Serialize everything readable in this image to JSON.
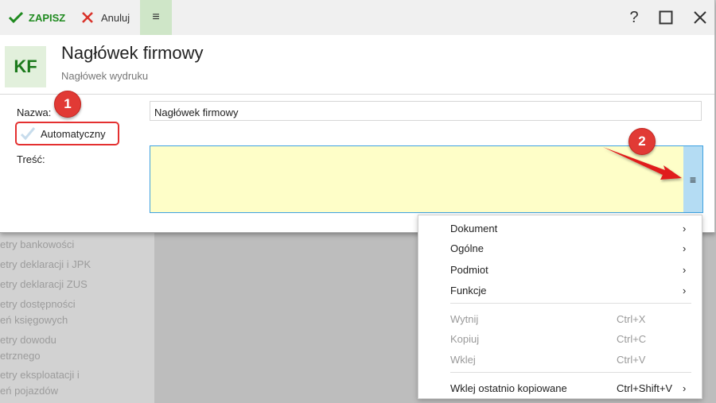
{
  "toolbar": {
    "save_label": "ZAPISZ",
    "cancel_label": "Anuluj",
    "menu_glyph": "≡",
    "help_glyph": "?",
    "maximize_glyph": "☐",
    "close_glyph": "✕"
  },
  "header": {
    "badge": "KF",
    "title": "Nagłówek firmowy",
    "subtitle": "Nagłówek wydruku"
  },
  "form": {
    "name_label": "Nazwa:",
    "name_value": "Nagłówek firmowy",
    "auto_label": "Automatyczny",
    "content_label": "Treść:",
    "content_menu_glyph": "≡"
  },
  "annotations": [
    "1",
    "2"
  ],
  "background_list": [
    "etry bankowości",
    "etry deklaracji i JPK",
    "etry deklaracji ZUS",
    "etry dostępności\neń księgowych",
    "etry dowodu\netrznego",
    "etry eksploatacji i\neń pojazdów"
  ],
  "context_menu": {
    "submenus": [
      "Dokument",
      "Ogólne",
      "Podmiot",
      "Funkcje"
    ],
    "clipboard": [
      {
        "label": "Wytnij",
        "shortcut": "Ctrl+X"
      },
      {
        "label": "Kopiuj",
        "shortcut": "Ctrl+C"
      },
      {
        "label": "Wklej",
        "shortcut": "Ctrl+V"
      }
    ],
    "paste_last": {
      "label": "Wklej ostatnio kopiowane",
      "shortcut": "Ctrl+Shift+V"
    },
    "submenu_glyph": "›"
  },
  "colors": {
    "save": "#1f8a1f",
    "cancel_icon": "#d9332b",
    "badge": "#e13a35",
    "content_bg": "#fefec8",
    "content_border": "#3ea1e0"
  }
}
